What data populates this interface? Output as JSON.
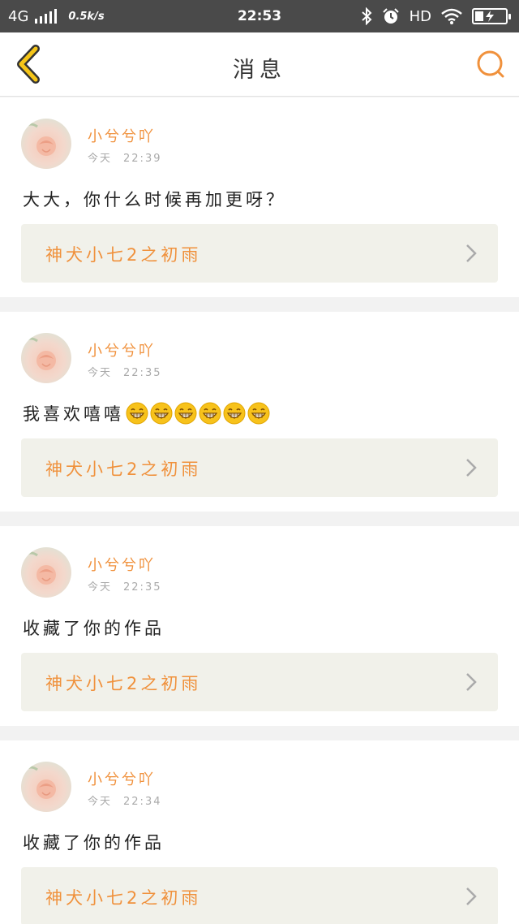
{
  "status_bar": {
    "network": "4G",
    "speed": "0.5k/s",
    "time": "22:53",
    "hd": "HD"
  },
  "header": {
    "title": "消息"
  },
  "colors": {
    "accent": "#f0913c",
    "back_arrow": "#f5c518"
  },
  "messages": [
    {
      "username": "小兮兮吖",
      "day": "今天",
      "time": "22:39",
      "text": "大大，你什么时候再加更呀？",
      "emoji_count": 0,
      "work_title": "神犬小七2之初雨"
    },
    {
      "username": "小兮兮吖",
      "day": "今天",
      "time": "22:35",
      "text": "我喜欢嘻嘻",
      "emoji_count": 6,
      "work_title": "神犬小七2之初雨"
    },
    {
      "username": "小兮兮吖",
      "day": "今天",
      "time": "22:35",
      "text": "收藏了你的作品",
      "emoji_count": 0,
      "work_title": "神犬小七2之初雨"
    },
    {
      "username": "小兮兮吖",
      "day": "今天",
      "time": "22:34",
      "text": "收藏了你的作品",
      "emoji_count": 0,
      "work_title": "神犬小七2之初雨"
    }
  ]
}
